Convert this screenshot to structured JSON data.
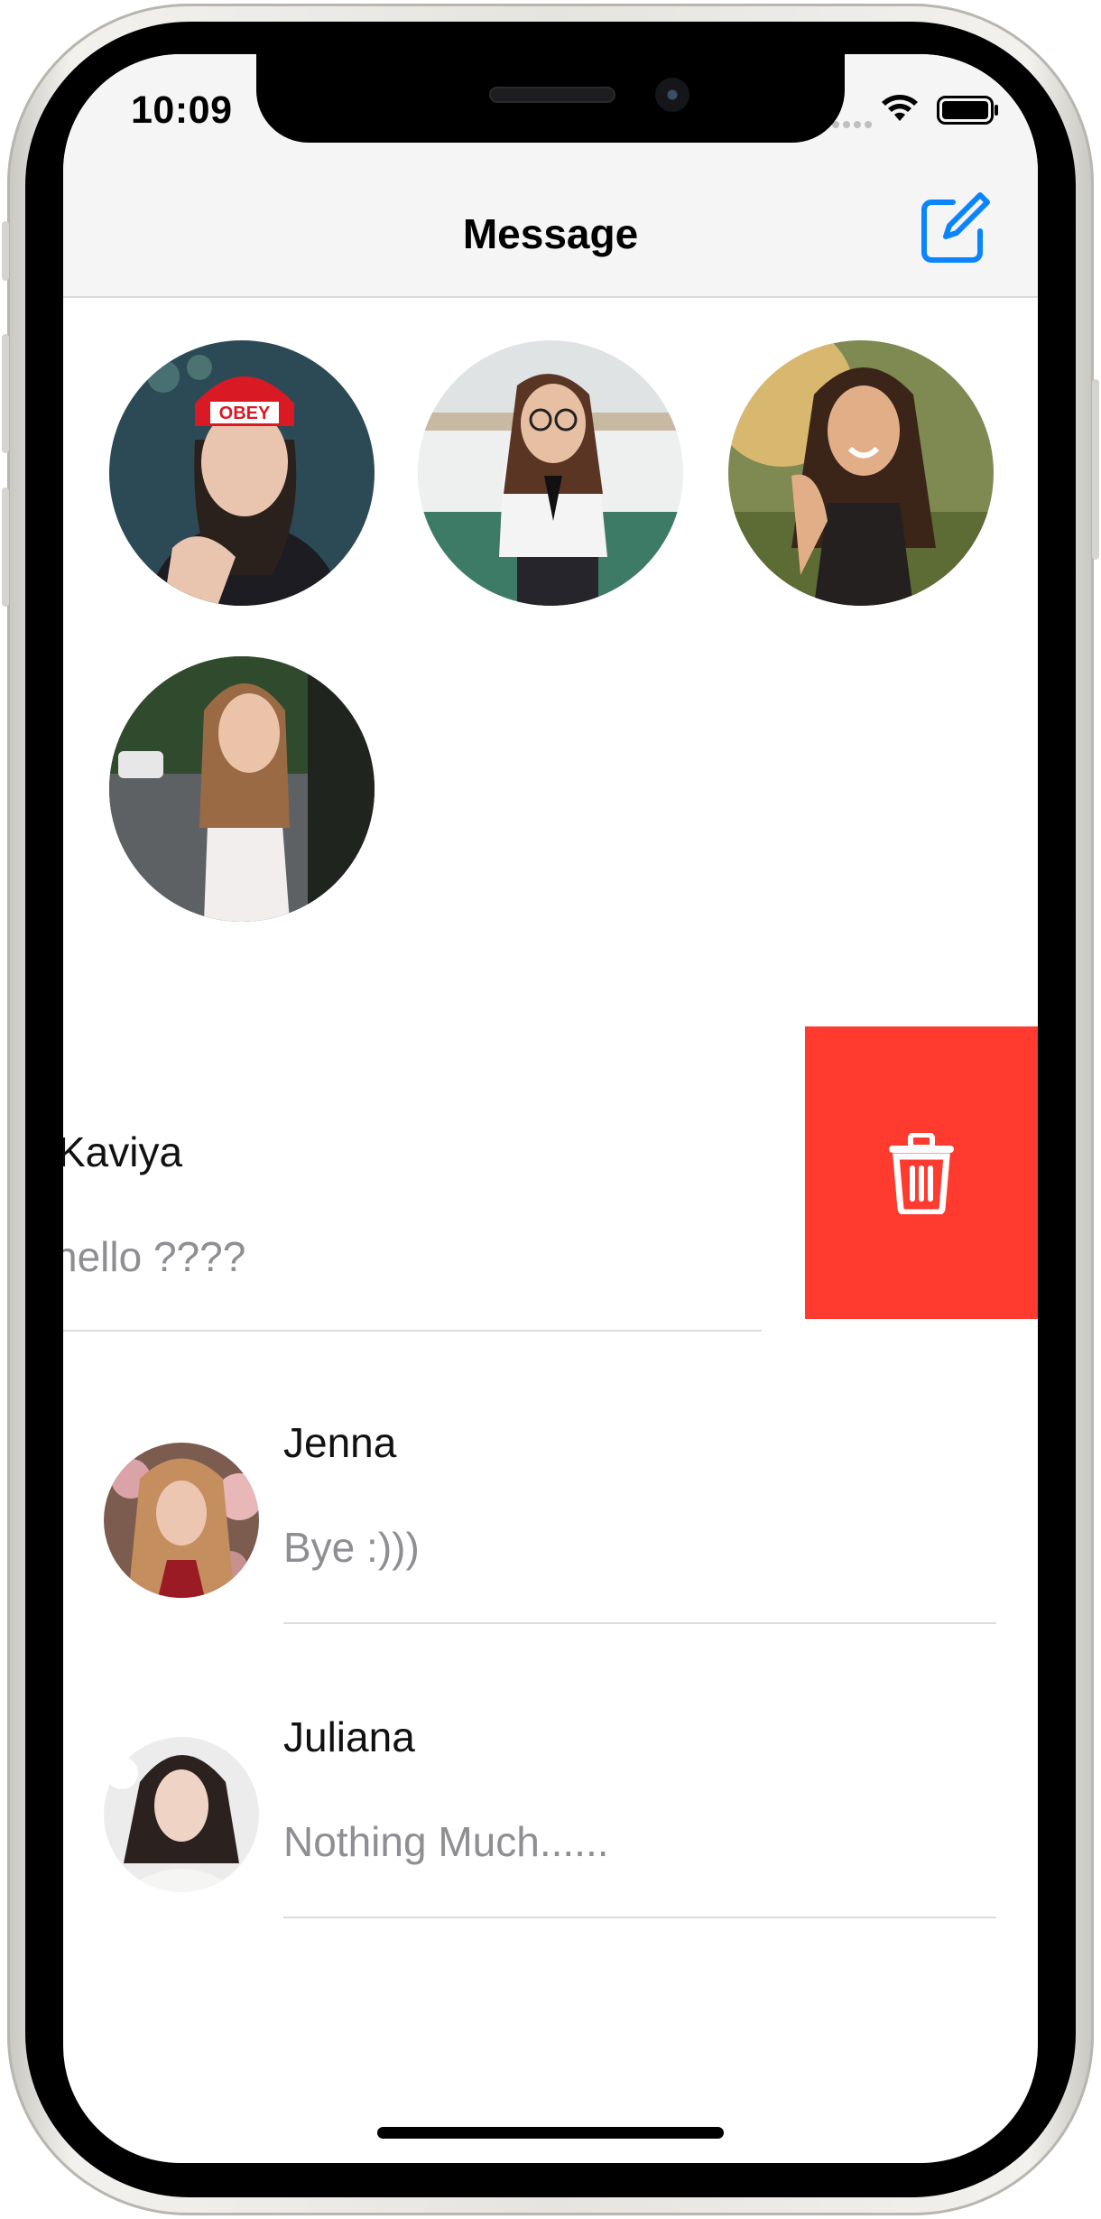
{
  "status_bar": {
    "time": "10:09"
  },
  "nav": {
    "title": "Message",
    "compose_icon": "compose-icon"
  },
  "stories": [
    {
      "name": "story-1"
    },
    {
      "name": "story-2"
    },
    {
      "name": "story-3"
    },
    {
      "name": "story-4"
    }
  ],
  "conversations": [
    {
      "name": "Kaviya",
      "preview": "hello ????",
      "swiped": true
    },
    {
      "name": "Jenna",
      "preview": "Bye :)))"
    },
    {
      "name": "Juliana",
      "preview": "Nothing Much......"
    }
  ],
  "swipe_action": {
    "icon": "trash-icon",
    "color": "#ff3b30"
  },
  "colors": {
    "accent": "#0a84ff",
    "delete": "#ff3b30",
    "secondary_text": "#8e8e93"
  }
}
